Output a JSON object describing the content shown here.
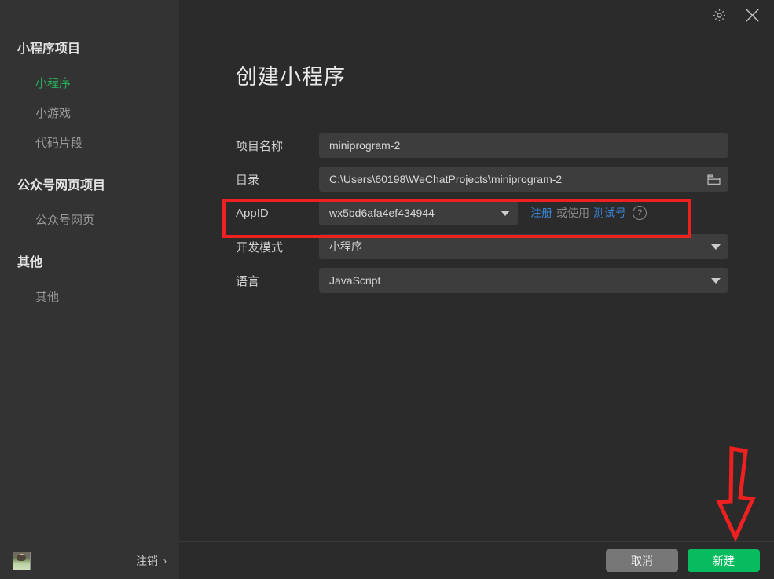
{
  "window": {
    "settings_icon": "gear-icon",
    "close_icon": "close-icon"
  },
  "sidebar": {
    "groups": [
      {
        "title": "小程序项目",
        "items": [
          {
            "label": "小程序",
            "active": true
          },
          {
            "label": "小游戏",
            "active": false
          },
          {
            "label": "代码片段",
            "active": false
          }
        ]
      },
      {
        "title": "公众号网页项目",
        "items": [
          {
            "label": "公众号网页",
            "active": false
          }
        ]
      },
      {
        "title": "其他",
        "items": [
          {
            "label": "其他",
            "active": false
          }
        ]
      }
    ],
    "footer": {
      "avatar": "user-avatar",
      "logout_label": "注销",
      "logout_chevron": "›"
    }
  },
  "page": {
    "title": "创建小程序"
  },
  "form": {
    "project_name": {
      "label": "项目名称",
      "value": "miniprogram-2"
    },
    "directory": {
      "label": "目录",
      "value": "C:\\Users\\60198\\WeChatProjects\\miniprogram-2",
      "icon": "folder-icon"
    },
    "appid": {
      "label": "AppID",
      "value": "wx5bd6afa4ef434944",
      "caret": "chevron-down-icon",
      "register_link": "注册",
      "or_text": "或使用",
      "test_link": "测试号",
      "help_icon": "question-mark-icon"
    },
    "dev_mode": {
      "label": "开发模式",
      "value": "小程序",
      "caret": "chevron-down-icon"
    },
    "language": {
      "label": "语言",
      "value": "JavaScript",
      "caret": "chevron-down-icon"
    }
  },
  "footer": {
    "cancel_label": "取消",
    "create_label": "新建"
  },
  "annotations": {
    "highlight_box": "appid-row-highlight",
    "arrow": "red-down-arrow-to-create-button",
    "color": "#ef2020"
  },
  "colors": {
    "accent_green": "#09bb5f",
    "active_nav": "#2aa85a",
    "link_blue": "#3a86d8",
    "annotation_red": "#ef2020",
    "sidebar_bg": "#333333",
    "main_bg": "#2b2b2b",
    "field_bg": "#3d3d3d"
  }
}
